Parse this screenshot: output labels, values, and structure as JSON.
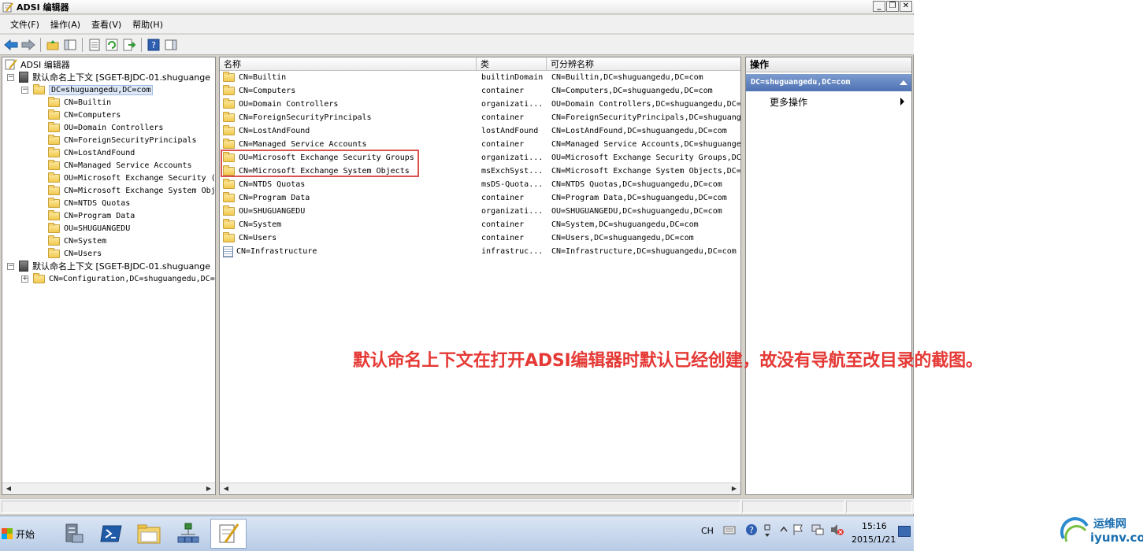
{
  "window": {
    "title": "ADSI 编辑器",
    "controls": [
      "_",
      "❐",
      "✕"
    ]
  },
  "menu": [
    "文件(F)",
    "操作(A)",
    "查看(V)",
    "帮助(H)"
  ],
  "tree": {
    "root": "ADSI 编辑器",
    "ctx1": "默认命名上下文 [SGET-BJDC-01.shuguange",
    "domain": "DC=shuguangedu,DC=com",
    "children": [
      "CN=Builtin",
      "CN=Computers",
      "OU=Domain Controllers",
      "CN=ForeignSecurityPrincipals",
      "CN=LostAndFound",
      "CN=Managed Service Accounts",
      "OU=Microsoft Exchange Security (",
      "CN=Microsoft Exchange System Obj",
      "CN=NTDS Quotas",
      "CN=Program Data",
      "OU=SHUGUANGEDU",
      "CN=System",
      "CN=Users"
    ],
    "ctx2": "默认命名上下文 [SGET-BJDC-01.shuguange",
    "config": "CN=Configuration,DC=shuguangedu,DC="
  },
  "list": {
    "headers": [
      "名称",
      "类",
      "可分辨名称"
    ],
    "rows": [
      {
        "name": "CN=Builtin",
        "class": "builtinDomain",
        "dn": "CN=Builtin,DC=shuguangedu,DC=com",
        "icon": "folder-icon"
      },
      {
        "name": "CN=Computers",
        "class": "container",
        "dn": "CN=Computers,DC=shuguangedu,DC=com",
        "icon": "folder-icon"
      },
      {
        "name": "OU=Domain Controllers",
        "class": "organizati...",
        "dn": "OU=Domain Controllers,DC=shuguangedu,DC=",
        "icon": "folder-icon"
      },
      {
        "name": "CN=ForeignSecurityPrincipals",
        "class": "container",
        "dn": "CN=ForeignSecurityPrincipals,DC=shuguang",
        "icon": "folder-icon"
      },
      {
        "name": "CN=LostAndFound",
        "class": "lostAndFound",
        "dn": "CN=LostAndFound,DC=shuguangedu,DC=com",
        "icon": "folder-icon"
      },
      {
        "name": "CN=Managed Service Accounts",
        "class": "container",
        "dn": "CN=Managed Service Accounts,DC=shuguange",
        "icon": "folder-icon"
      },
      {
        "name": "OU=Microsoft Exchange Security Groups",
        "class": "organizati...",
        "dn": "OU=Microsoft Exchange Security Groups,DC",
        "icon": "folder-icon"
      },
      {
        "name": "CN=Microsoft Exchange System Objects",
        "class": "msExchSyst...",
        "dn": "CN=Microsoft Exchange System Objects,DC=",
        "icon": "folder-icon"
      },
      {
        "name": "CN=NTDS Quotas",
        "class": "msDS-Quota...",
        "dn": "CN=NTDS Quotas,DC=shuguangedu,DC=com",
        "icon": "folder-icon"
      },
      {
        "name": "CN=Program Data",
        "class": "container",
        "dn": "CN=Program Data,DC=shuguangedu,DC=com",
        "icon": "folder-icon"
      },
      {
        "name": "OU=SHUGUANGEDU",
        "class": "organizati...",
        "dn": "OU=SHUGUANGEDU,DC=shuguangedu,DC=com",
        "icon": "folder-icon"
      },
      {
        "name": "CN=System",
        "class": "container",
        "dn": "CN=System,DC=shuguangedu,DC=com",
        "icon": "folder-icon"
      },
      {
        "name": "CN=Users",
        "class": "container",
        "dn": "CN=Users,DC=shuguangedu,DC=com",
        "icon": "folder-icon"
      },
      {
        "name": "CN=Infrastructure",
        "class": "infrastruc...",
        "dn": "CN=Infrastructure,DC=shuguangedu,DC=com",
        "icon": "document-icon"
      }
    ]
  },
  "actions": {
    "header": "操作",
    "selected": "DC=shuguangedu,DC=com",
    "more": "更多操作"
  },
  "annotation": "默认命名上下文在打开ADSI编辑器时默认已经创建，故没有导航至改目录的截图。",
  "taskbar": {
    "start": "开始",
    "lang": "CH",
    "time": "15:16",
    "date": "2015/1/21"
  },
  "watermark": {
    "top": "运维网",
    "bottom": "iyunv.com"
  },
  "colors": {
    "highlight": "#d9534f",
    "annotation": "#e53935",
    "selection": "#4e72b3"
  }
}
